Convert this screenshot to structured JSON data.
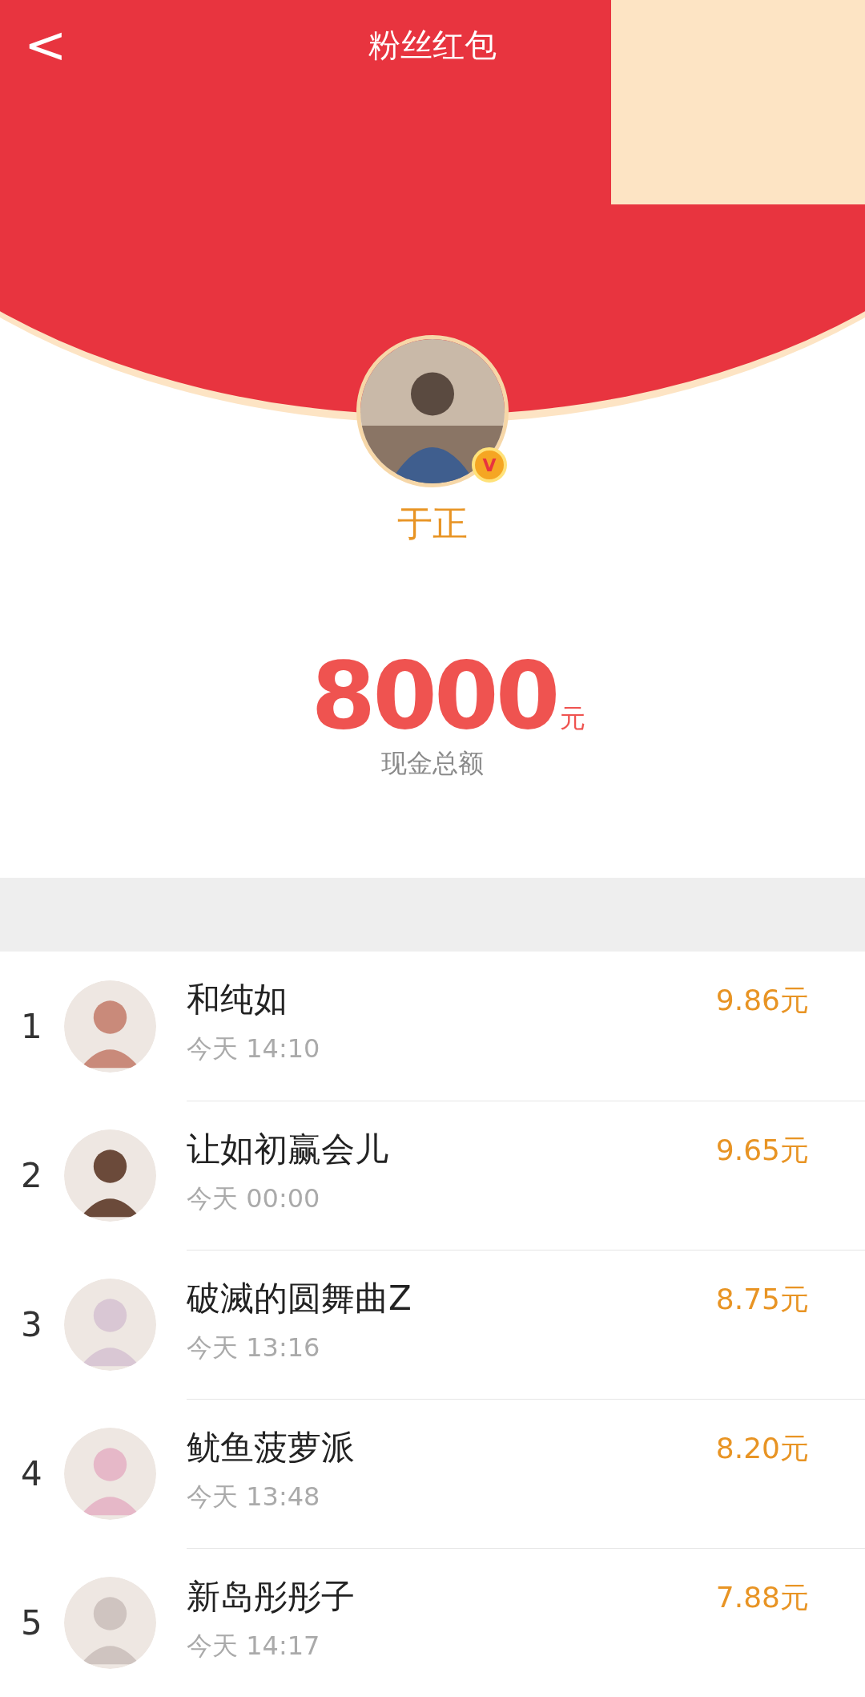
{
  "header": {
    "back": "<",
    "title": "粉丝红包"
  },
  "profile": {
    "name": "于正",
    "badge": "V"
  },
  "total": {
    "amount": "8000",
    "unit": "元",
    "label": "现金总额"
  },
  "rows": [
    {
      "rank": "1",
      "name": "和纯如",
      "time": "今天 14:10",
      "amount": "9.86元"
    },
    {
      "rank": "2",
      "name": "让如初赢会儿",
      "time": "今天 00:00",
      "amount": "9.65元"
    },
    {
      "rank": "3",
      "name": "破滅的圆舞曲Z",
      "time": "今天 13:16",
      "amount": "8.75元"
    },
    {
      "rank": "4",
      "name": "鱿鱼菠萝派",
      "time": "今天 13:48",
      "amount": "8.20元"
    },
    {
      "rank": "5",
      "name": "新岛彤彤子",
      "time": "今天 14:17",
      "amount": "7.88元"
    }
  ]
}
